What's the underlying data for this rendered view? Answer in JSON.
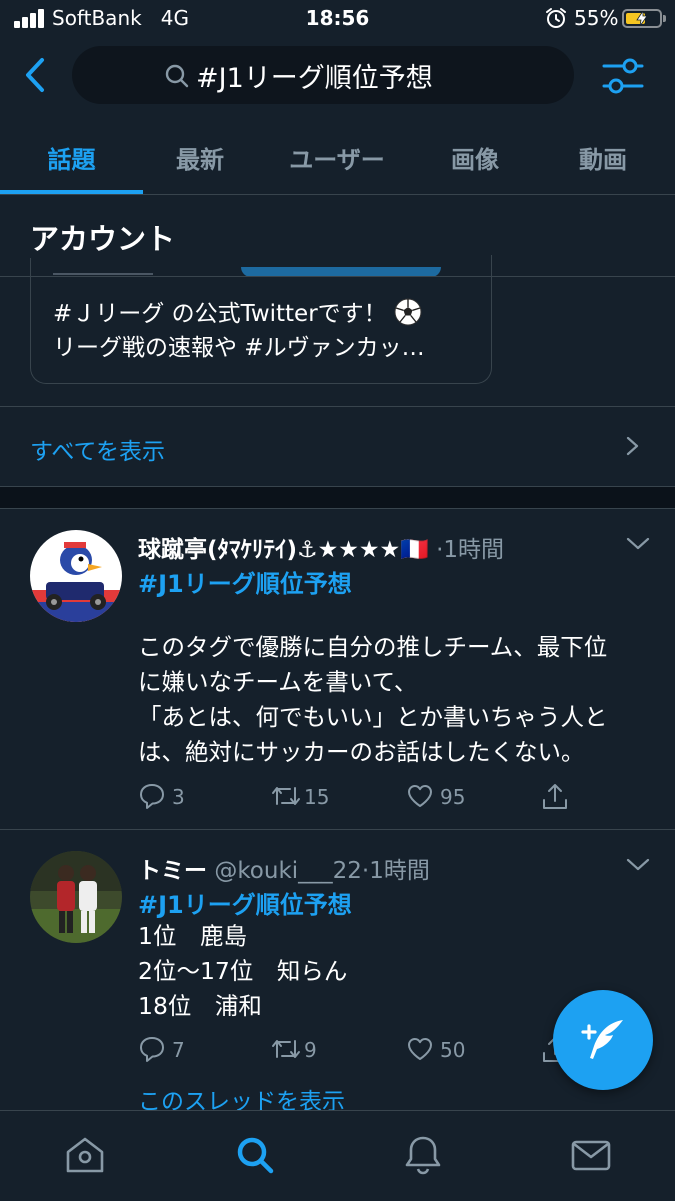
{
  "status_bar": {
    "carrier": "SoftBank",
    "network": "4G",
    "time": "18:56",
    "battery": "55%"
  },
  "search": {
    "query": "#J1リーグ順位予想"
  },
  "tabs": [
    {
      "label": "話題",
      "active": true
    },
    {
      "label": "最新"
    },
    {
      "label": "ユーザー"
    },
    {
      "label": "画像"
    },
    {
      "label": "動画"
    }
  ],
  "section": {
    "title": "アカウント"
  },
  "account_card": {
    "bio_line1": "#Ｊリーグ の公式Twitterです！",
    "bio_line2": "リーグ戦の速報や #ルヴァンカッ…"
  },
  "show_all": "すべてを表示",
  "tweets": [
    {
      "name": "球蹴亭(ﾀﾏｹﾘﾃｲ)⚓★★★★🇫🇷",
      "meta": "·1時間",
      "hashtag": "#J1リーグ順位予想",
      "lines": [
        "このタグで優勝に自分の推しチーム、最下位",
        "に嫌いなチームを書いて、",
        "「あとは、何でもいい」とか書いちゃう人と",
        "は、絶対にサッカーのお話はしたくない。"
      ],
      "replies": "3",
      "retweets": "15",
      "likes": "95"
    },
    {
      "name": "トミー",
      "meta": "@kouki___22·1時間",
      "hashtag": "#J1リーグ順位予想",
      "lines": [
        "1位　鹿島",
        "2位〜17位　知らん",
        "18位　浦和"
      ],
      "replies": "7",
      "retweets": "9",
      "likes": "50"
    }
  ],
  "thread_link": "このスレッドを表示",
  "colors": {
    "background": "#15202b",
    "accent": "#1da1f2",
    "muted": "#8899a6",
    "border": "#38444d"
  }
}
